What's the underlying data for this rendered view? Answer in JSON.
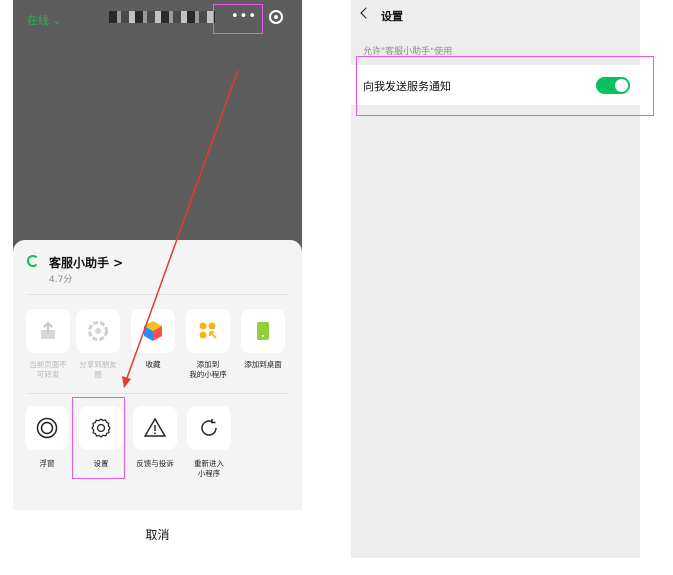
{
  "left": {
    "status": "在线 ⌄",
    "more_icon": "more-dots-icon",
    "close_icon": "capsule-close-icon",
    "app": {
      "name": "客服小助手 >",
      "score": "4.7分"
    },
    "row1": [
      {
        "label": "当前页面不\n可转发",
        "icon": "share-icon",
        "disabled": true
      },
      {
        "label": "分享到朋友\n圈",
        "icon": "moments-icon",
        "disabled": true
      },
      {
        "label": "收藏",
        "icon": "favorite-cube-icon",
        "disabled": false
      },
      {
        "label": "添加到\n我的小程序",
        "icon": "add-to-miniprogram-icon",
        "disabled": false
      },
      {
        "label": "添加到桌面",
        "icon": "add-to-desktop-icon",
        "disabled": false
      }
    ],
    "row2": [
      {
        "label": "浮窗",
        "icon": "float-window-icon"
      },
      {
        "label": "设置",
        "icon": "settings-gear-icon"
      },
      {
        "label": "反馈与投诉",
        "icon": "warning-triangle-icon"
      },
      {
        "label": "重新进入\n小程序",
        "icon": "reload-icon"
      }
    ],
    "cancel": "取消"
  },
  "right": {
    "title": "设置",
    "caption": "允许\"客服小助手\"使用",
    "setting_label": "向我发送服务通知",
    "toggle_on": true
  },
  "colors": {
    "accent": "#07c160",
    "annotation": "#e45be4",
    "arrow": "#e53935"
  }
}
